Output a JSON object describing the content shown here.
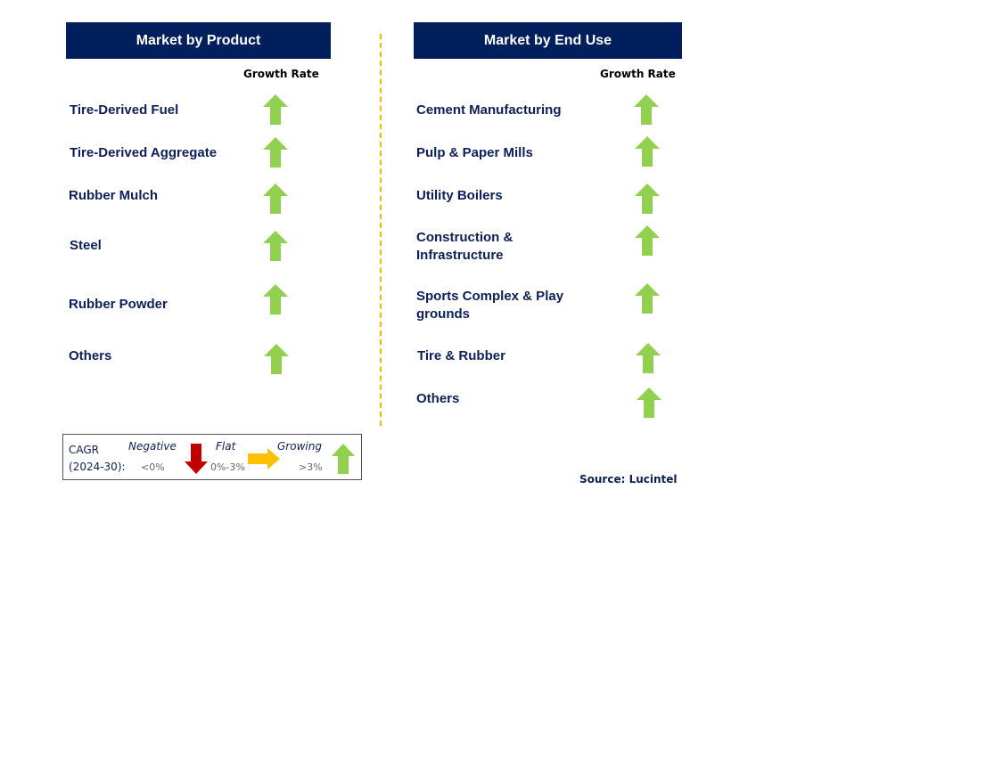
{
  "left_panel": {
    "title": "Market by Product",
    "growth_header": "Growth Rate",
    "rows": [
      {
        "label": "Tire-Derived Fuel",
        "trend": "growing"
      },
      {
        "label": "Tire-Derived Aggregate",
        "trend": "growing"
      },
      {
        "label": "Rubber Mulch",
        "trend": "growing"
      },
      {
        "label": "Steel",
        "trend": "growing"
      },
      {
        "label": "Rubber Powder",
        "trend": "growing"
      },
      {
        "label": "Others",
        "trend": "growing"
      }
    ]
  },
  "right_panel": {
    "title": "Market by End Use",
    "growth_header": "Growth Rate",
    "rows": [
      {
        "label": "Cement Manufacturing",
        "trend": "growing"
      },
      {
        "label": "Pulp & Paper Mills",
        "trend": "growing"
      },
      {
        "label": "Utility Boilers",
        "trend": "growing"
      },
      {
        "label": "Construction & Infrastructure",
        "trend": "growing"
      },
      {
        "label": "Sports Complex & Play grounds",
        "trend": "growing"
      },
      {
        "label": "Tire & Rubber",
        "trend": "growing"
      },
      {
        "label": "Others",
        "trend": "growing"
      }
    ]
  },
  "legend": {
    "cagr_label": "CAGR",
    "period": "(2024-30):",
    "negative": {
      "label": "Negative",
      "range": "<0%",
      "color": "#c00000",
      "icon": "down-arrow"
    },
    "flat": {
      "label": "Flat",
      "range": "0%-3%",
      "color": "#ffc000",
      "icon": "right-arrow"
    },
    "growing": {
      "label": "Growing",
      "range": ">3%",
      "color": "#92d050",
      "icon": "up-arrow"
    }
  },
  "source": "Source: Lucintel",
  "colors": {
    "header_bg": "#001f5c",
    "label_text": "#0d1f5a",
    "divider": "#f5b800"
  }
}
